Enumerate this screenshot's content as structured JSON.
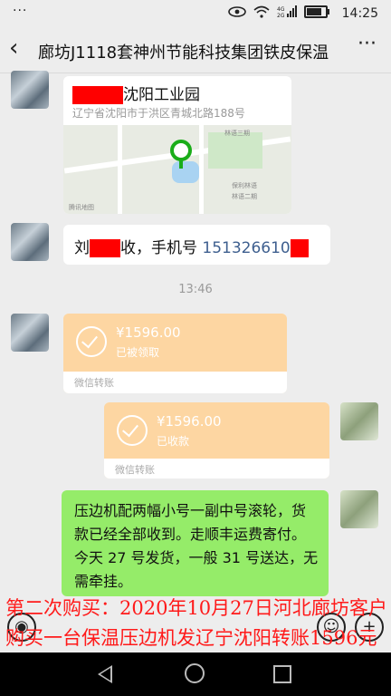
{
  "status_bar": {
    "left_icon": "more-dots",
    "time": "14:25",
    "icons": [
      "eye-icon",
      "wifi-icon",
      "signal-4g-icon",
      "signal-2g-icon",
      "battery-icon"
    ],
    "battery_level": 0.8
  },
  "header": {
    "back_icon": "chevron-left-icon",
    "title": "廊坊J1118套神州节能科技集团铁皮保温",
    "more_icon": "more-dots-icon"
  },
  "messages": {
    "location": {
      "place_name": "沈阳工业园",
      "address": "辽宁省沈阳市于洪区青城北路188号",
      "map_labels": [
        "林语三期",
        "保利林语",
        "林语二期",
        "腾讯地图"
      ]
    },
    "contact": {
      "prefix": "刘",
      "middle": "收，手机号",
      "phone": "151326610"
    },
    "timestamp": "13:46",
    "transfer_received": {
      "amount": "¥1596.00",
      "status": "已被领取",
      "footer": "微信转账"
    },
    "transfer_sent": {
      "amount": "¥1596.00",
      "status": "已收款",
      "footer": "微信转账"
    },
    "text_message": "压边机配两幅小号一副中号滚轮，货款已经全部收到。走顺丰运费寄付。今天 27 号发货，一般 31 号送达，无需牵挂。"
  },
  "overlay_caption": {
    "line1": "第二次购买：2020年10月27日河北廊坊客户",
    "line2": "购买一台保温压边机发辽宁沈阳转账1596元"
  },
  "input_bar": {
    "voice_icon": "voice-icon",
    "emoji_icon": "emoji-icon",
    "plus_icon": "plus-icon"
  },
  "nav_bar": {
    "back": "nav-back-icon",
    "home": "nav-home-icon",
    "recent": "nav-recent-icon"
  },
  "colors": {
    "chat_bg": "#ededed",
    "sent_bubble": "#95ec69",
    "transfer_orange": "#fdd6a2",
    "caption_red": "#ff1a1a",
    "redaction": "#ff0000"
  }
}
